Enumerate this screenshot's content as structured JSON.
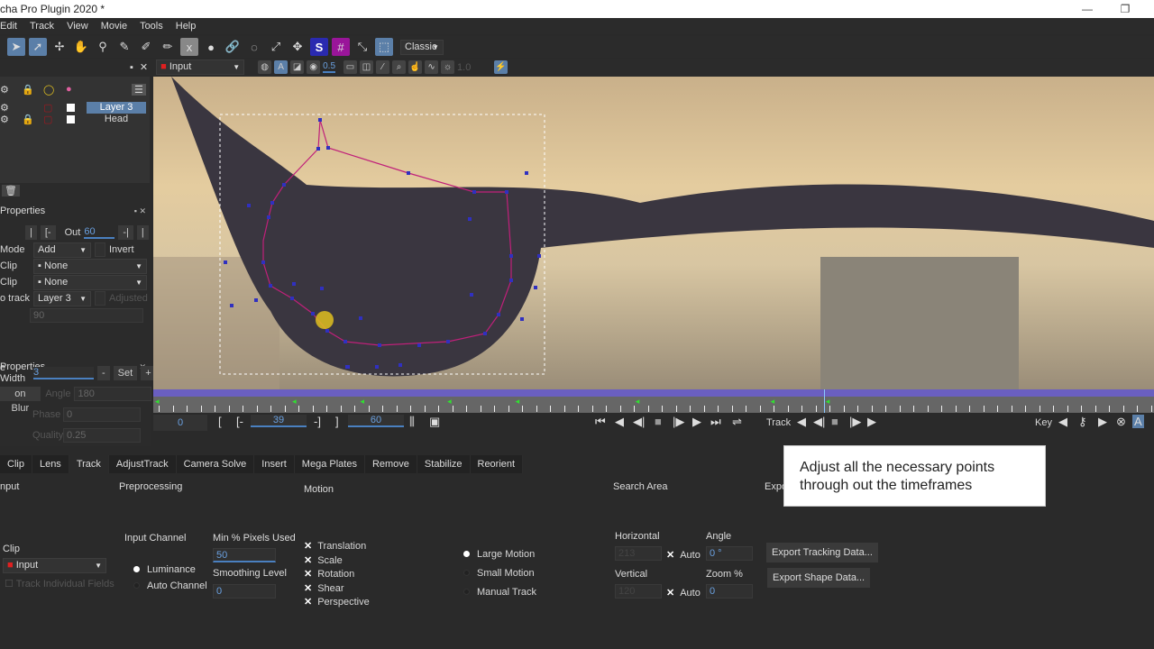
{
  "window": {
    "title": "cha Pro Plugin 2020 *"
  },
  "menu": [
    "Edit",
    "Track",
    "View",
    "Movie",
    "Tools",
    "Help"
  ],
  "toolbar": {
    "view_mode": "Classic",
    "clip": "Input",
    "opacity": "0.5",
    "brightness": "1.0"
  },
  "layers": {
    "items": [
      {
        "name": "Layer 3",
        "selected": true
      },
      {
        "name": "Head",
        "selected": false
      }
    ]
  },
  "layer_properties": {
    "title": "Properties",
    "out_label": "Out",
    "out_value": "60",
    "mode_label": "Mode",
    "mode_value": "Add",
    "invert_label": "Invert",
    "clip1_label": "Clip",
    "clip1_value": "None",
    "clip2_label": "Clip",
    "clip2_value": "None",
    "track_label": "o track",
    "track_value": "Layer 3",
    "adjusted_label": "Adjusted",
    "adjusted_value": "90"
  },
  "edge_properties": {
    "title": "Properties",
    "width_label": "e Width",
    "width_value": "3",
    "minus": "-",
    "set": "Set",
    "plus": "+",
    "blur_label": "on Blur",
    "angle_label": "Angle",
    "angle_value": "180",
    "phase_label": "Phase",
    "phase_value": "0",
    "quality_label": "Quality",
    "quality_value": "0.25"
  },
  "timeline": {
    "current": "0",
    "in": "39",
    "out": "60",
    "track_label": "Track",
    "key_label": "Key",
    "playhead_fraction": 0.67,
    "keyframes": [
      0,
      0.137,
      0.205,
      0.292,
      0.36,
      0.48,
      0.615,
      0.67
    ]
  },
  "tabs": [
    "Clip",
    "Lens",
    "Track",
    "AdjustTrack",
    "Camera Solve",
    "Insert",
    "Mega Plates",
    "Remove",
    "Stabilize",
    "Reorient"
  ],
  "active_tab": "Track",
  "track_panel": {
    "input_section": "nput",
    "preprocessing_section": "Preprocessing",
    "motion_section": "Motion",
    "search_section": "Search Area",
    "export_section": "Expo",
    "clip_label": "Clip",
    "clip_value": "Input",
    "track_fields": "Track Individual Fields",
    "input_channel_label": "Input Channel",
    "luminance": "Luminance",
    "auto_channel": "Auto Channel",
    "min_pixels_label": "Min % Pixels Used",
    "min_pixels_value": "50",
    "smoothing_label": "Smoothing Level",
    "smoothing_value": "0",
    "motion_types": [
      "Translation",
      "Scale",
      "Rotation",
      "Shear",
      "Perspective"
    ],
    "motion_modes": [
      {
        "label": "Large Motion",
        "on": true
      },
      {
        "label": "Small Motion",
        "on": false
      },
      {
        "label": "Manual Track",
        "on": false
      }
    ],
    "horizontal_label": "Horizontal",
    "horizontal_value": "213",
    "vertical_label": "Vertical",
    "vertical_value": "120",
    "auto": "Auto",
    "angle_label": "Angle",
    "angle_value": "0 °",
    "zoom_label": "Zoom %",
    "zoom_value": "0",
    "export_tracking": "Export Tracking Data...",
    "export_shape": "Export Shape Data..."
  },
  "annotation": "Adjust all the necessary points through out the timeframes",
  "colors": {
    "accent": "#5b7fa8",
    "timeline": "#6a5fc0",
    "spline": "#c0207a",
    "points": "#3030c0"
  }
}
